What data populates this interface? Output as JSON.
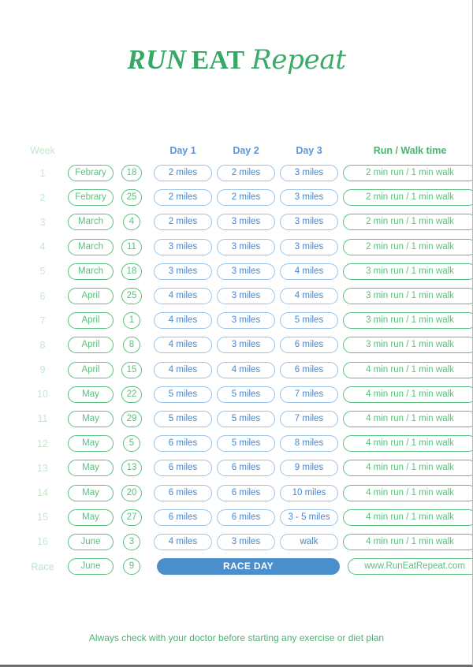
{
  "logo": {
    "part1": "RUN",
    "part2": "EAT",
    "part3": "Repeat"
  },
  "headers": {
    "week": "Week",
    "day1": "Day 1",
    "day2": "Day 2",
    "day3": "Day 3",
    "runwalk": "Run / Walk time"
  },
  "colors": {
    "green": "#5cbf7e",
    "green_text": "#4cb270",
    "light_green": "#c6e7cc",
    "blue_border": "#9cc3e8",
    "blue_text": "#4a86c8",
    "blue_header": "#5b95d6",
    "raceday_fill": "#4a8ecb",
    "logo_green": "#36a866"
  },
  "rows": [
    {
      "week": "1",
      "month": "Febrary",
      "date": "18",
      "day1": "2 miles",
      "day2": "2 miles",
      "day3": "3 miles",
      "runwalk": "2 min run / 1 min walk"
    },
    {
      "week": "2",
      "month": "Febrary",
      "date": "25",
      "day1": "2 miles",
      "day2": "2 miles",
      "day3": "3 miles",
      "runwalk": "2 min run / 1 min walk"
    },
    {
      "week": "3",
      "month": "March",
      "date": "4",
      "day1": "2 miles",
      "day2": "3 miles",
      "day3": "3 miles",
      "runwalk": "2 min run / 1 min walk"
    },
    {
      "week": "4",
      "month": "March",
      "date": "11",
      "day1": "3 miles",
      "day2": "3 miles",
      "day3": "3 miles",
      "runwalk": "2 min run / 1 min walk"
    },
    {
      "week": "5",
      "month": "March",
      "date": "18",
      "day1": "3 miles",
      "day2": "3 miles",
      "day3": "4 miles",
      "runwalk": "3 min run / 1 min walk"
    },
    {
      "week": "6",
      "month": "April",
      "date": "25",
      "day1": "4 miles",
      "day2": "3 miles",
      "day3": "4 miles",
      "runwalk": "3 min run / 1 min walk"
    },
    {
      "week": "7",
      "month": "April",
      "date": "1",
      "day1": "4 miles",
      "day2": "3 miles",
      "day3": "5 miles",
      "runwalk": "3 min run / 1 min walk"
    },
    {
      "week": "8",
      "month": "April",
      "date": "8",
      "day1": "4 miles",
      "day2": "3 miles",
      "day3": "6 miles",
      "runwalk": "3 min run / 1 min walk"
    },
    {
      "week": "9",
      "month": "April",
      "date": "15",
      "day1": "4 miles",
      "day2": "4 miles",
      "day3": "6 miles",
      "runwalk": "4 min run / 1 min walk"
    },
    {
      "week": "10",
      "month": "May",
      "date": "22",
      "day1": "5 miles",
      "day2": "5 miles",
      "day3": "7 miles",
      "runwalk": "4 min run / 1 min walk"
    },
    {
      "week": "11",
      "month": "May",
      "date": "29",
      "day1": "5 miles",
      "day2": "5 miles",
      "day3": "7 miles",
      "runwalk": "4 min run / 1 min walk"
    },
    {
      "week": "12",
      "month": "May",
      "date": "5",
      "day1": "6 miles",
      "day2": "5 miles",
      "day3": "8 miles",
      "runwalk": "4 min run / 1 min walk"
    },
    {
      "week": "13",
      "month": "May",
      "date": "13",
      "day1": "6 miles",
      "day2": "6 miles",
      "day3": "9 miles",
      "runwalk": "4 min run / 1 min walk"
    },
    {
      "week": "14",
      "month": "May",
      "date": "20",
      "day1": "6 miles",
      "day2": "6 miles",
      "day3": "10 miles",
      "runwalk": "4 min run / 1 min walk"
    },
    {
      "week": "15",
      "month": "May",
      "date": "27",
      "day1": "6 miles",
      "day2": "6 miles",
      "day3": "3 - 5 miles",
      "runwalk": "4 min run / 1 min walk"
    },
    {
      "week": "16",
      "month": "June",
      "date": "3",
      "day1": "4 miles",
      "day2": "3 miles",
      "day3": "walk",
      "runwalk": "4 min run / 1 min walk"
    }
  ],
  "race_row": {
    "week": "Race",
    "month": "June",
    "date": "9",
    "banner": "RACE DAY",
    "url": "www.RunEatRepeat.com"
  },
  "footer": "Always check with your doctor before starting any exercise or diet plan"
}
